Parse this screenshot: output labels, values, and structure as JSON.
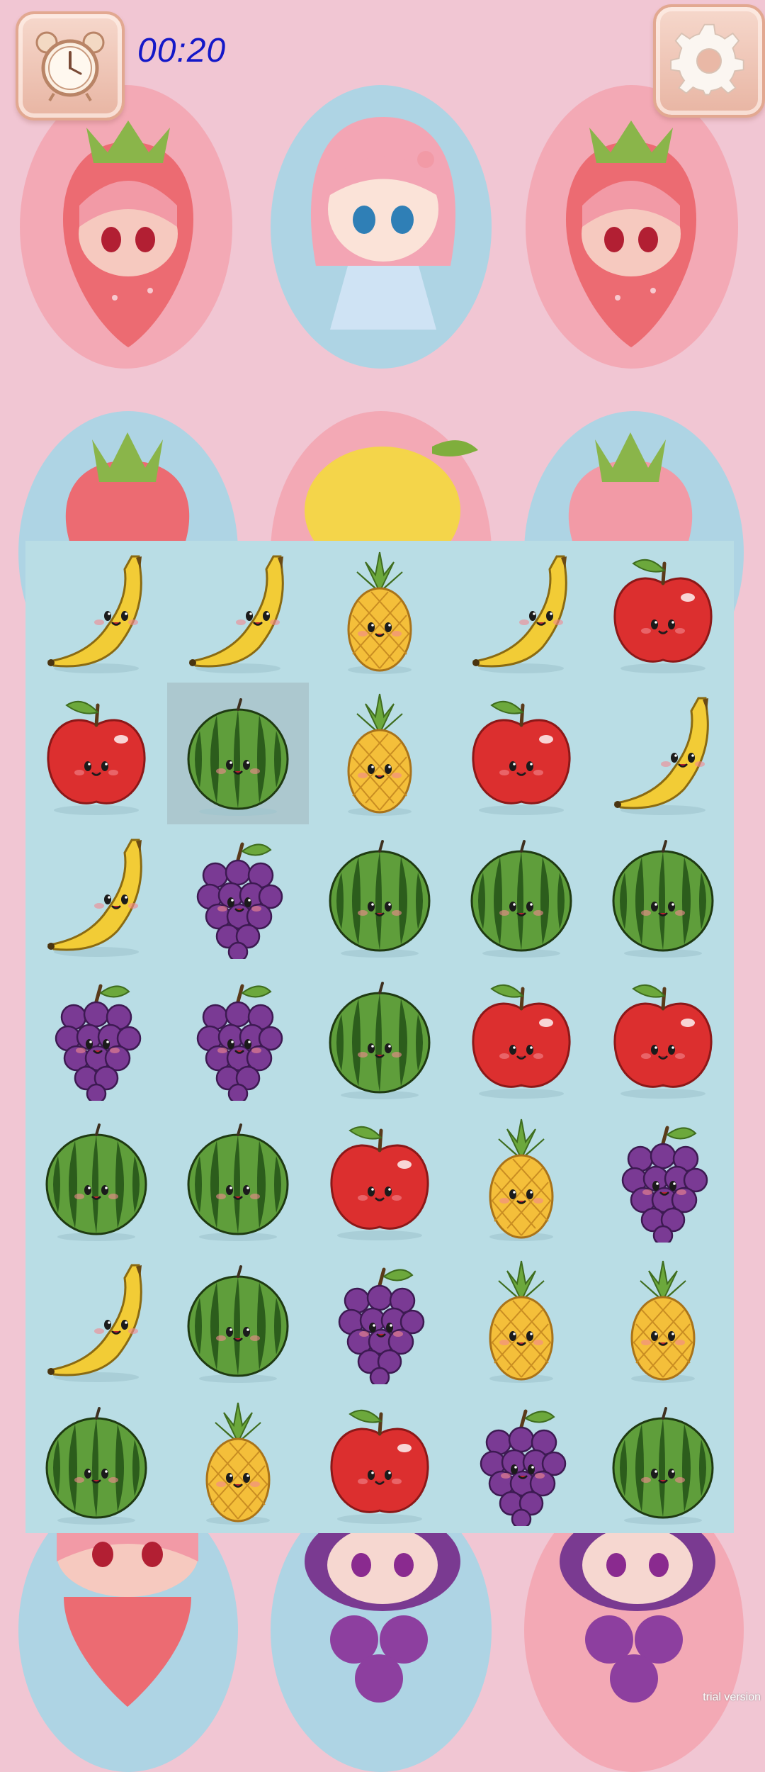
{
  "timer": "00:20",
  "watermark": "trial version",
  "board": [
    [
      "banana",
      "banana",
      "pineapple",
      "banana",
      "apple"
    ],
    [
      "apple",
      "watermelon",
      "pineapple",
      "apple",
      "banana"
    ],
    [
      "banana",
      "grapes",
      "watermelon",
      "watermelon",
      "watermelon"
    ],
    [
      "grapes",
      "grapes",
      "watermelon",
      "apple",
      "apple"
    ],
    [
      "watermelon",
      "watermelon",
      "apple",
      "pineapple",
      "grapes"
    ],
    [
      "banana",
      "watermelon",
      "grapes",
      "pineapple",
      "pineapple"
    ],
    [
      "watermelon",
      "pineapple",
      "apple",
      "grapes",
      "watermelon"
    ]
  ],
  "selected_cell": {
    "row": 1,
    "col": 1
  },
  "colors": {
    "timer": "#1418c8",
    "board_background": "#b9dde5",
    "page_background": "#f1c6d3"
  },
  "icons": {
    "alarm_button": "alarm-clock-icon",
    "settings_button": "gear-icon"
  }
}
